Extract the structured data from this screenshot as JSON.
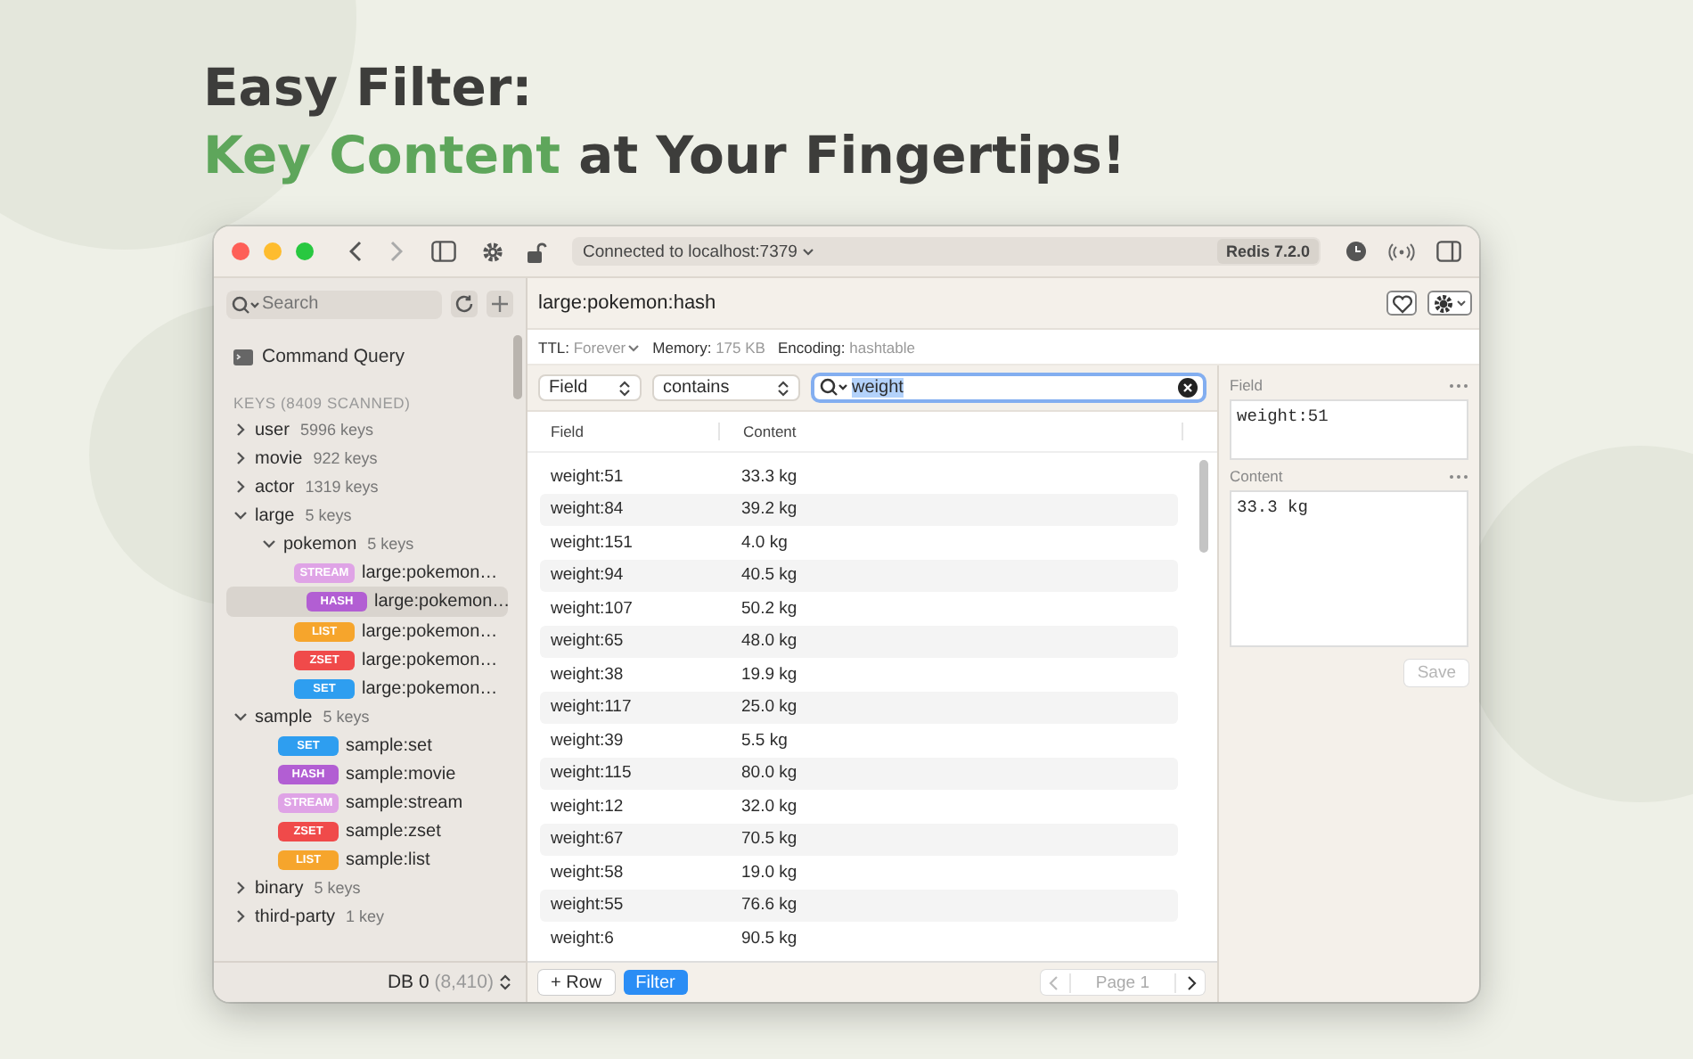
{
  "headline": {
    "line_1": "Easy Filter:",
    "line_2": [
      {
        "text": "Key Content",
        "highlight": true
      },
      {
        "text": " at Your Fingertips!",
        "highlight": false
      }
    ]
  },
  "titlebar": {
    "connection": "Connected to localhost:7379",
    "version": "Redis 7.2.0"
  },
  "sidebar": {
    "search": {
      "placeholder": "Search"
    },
    "command_query": "Command Query",
    "keys_heading": "KEYS (8409 SCANNED)",
    "tree": [
      {
        "kind": "folder",
        "name": "user",
        "count": "5996 keys",
        "expanded": false
      },
      {
        "kind": "folder",
        "name": "movie",
        "count": "922 keys",
        "expanded": false
      },
      {
        "kind": "folder",
        "name": "actor",
        "count": "1319 keys",
        "expanded": false
      },
      {
        "kind": "folder",
        "name": "large",
        "count": "5 keys",
        "expanded": true,
        "children": [
          {
            "kind": "folder",
            "name": "pokemon",
            "count": "5 keys",
            "expanded": true,
            "children": [
              {
                "kind": "key",
                "type": "STREAM",
                "color": "#dfa3e6",
                "name": "large:pokemon…",
                "selected": false
              },
              {
                "kind": "key",
                "type": "HASH",
                "color": "#b25ed3",
                "name": "large:pokemon…",
                "selected": true
              },
              {
                "kind": "key",
                "type": "LIST",
                "color": "#f6a52c",
                "name": "large:pokemon…",
                "selected": false
              },
              {
                "kind": "key",
                "type": "ZSET",
                "color": "#f04a4a",
                "name": "large:pokemon…",
                "selected": false
              },
              {
                "kind": "key",
                "type": "SET",
                "color": "#2e9ef0",
                "name": "large:pokemon…",
                "selected": false
              }
            ]
          }
        ]
      },
      {
        "kind": "folder",
        "name": "sample",
        "count": "5 keys",
        "expanded": true,
        "children": [
          {
            "kind": "key",
            "type": "SET",
            "color": "#2e9ef0",
            "name": "sample:set",
            "selected": false
          },
          {
            "kind": "key",
            "type": "HASH",
            "color": "#b25ed3",
            "name": "sample:movie",
            "selected": false
          },
          {
            "kind": "key",
            "type": "STREAM",
            "color": "#dfa3e6",
            "name": "sample:stream",
            "selected": false
          },
          {
            "kind": "key",
            "type": "ZSET",
            "color": "#f04a4a",
            "name": "sample:zset",
            "selected": false
          },
          {
            "kind": "key",
            "type": "LIST",
            "color": "#f6a52c",
            "name": "sample:list",
            "selected": false
          }
        ]
      },
      {
        "kind": "folder",
        "name": "binary",
        "count": "5 keys",
        "expanded": false
      },
      {
        "kind": "folder",
        "name": "third-party",
        "count": "1 key",
        "expanded": false
      }
    ],
    "footer": {
      "db": "DB 0",
      "count": "(8,410)"
    }
  },
  "main": {
    "key_title": "large:pokemon:hash",
    "info": [
      {
        "label": "TTL:",
        "value": "Forever",
        "dropdown": true
      },
      {
        "label": "Memory:",
        "value": "175 KB",
        "dropdown": false
      },
      {
        "label": "Encoding:",
        "value": "hashtable",
        "dropdown": false
      }
    ],
    "filter": {
      "field": "Field",
      "operator": "contains",
      "search_value": "weight"
    },
    "table": {
      "columns": [
        "Field",
        "Content"
      ],
      "rows": [
        [
          "weight:51",
          "33.3 kg"
        ],
        [
          "weight:84",
          "39.2 kg"
        ],
        [
          "weight:151",
          "4.0 kg"
        ],
        [
          "weight:94",
          "40.5 kg"
        ],
        [
          "weight:107",
          "50.2 kg"
        ],
        [
          "weight:65",
          "48.0 kg"
        ],
        [
          "weight:38",
          "19.9 kg"
        ],
        [
          "weight:117",
          "25.0 kg"
        ],
        [
          "weight:39",
          "5.5 kg"
        ],
        [
          "weight:115",
          "80.0 kg"
        ],
        [
          "weight:12",
          "32.0 kg"
        ],
        [
          "weight:67",
          "70.5 kg"
        ],
        [
          "weight:58",
          "19.0 kg"
        ],
        [
          "weight:55",
          "76.6 kg"
        ],
        [
          "weight:6",
          "90.5 kg"
        ]
      ]
    },
    "footer": {
      "add_row": "+ Row",
      "filter_button": {
        "label": "Filter",
        "selected": true
      },
      "page": "Page 1"
    }
  },
  "detail": {
    "field_label": "Field",
    "field_value": "weight:51",
    "content_label": "Content",
    "content_value": "33.3 kg",
    "save": {
      "label": "Save",
      "disabled": true
    }
  }
}
